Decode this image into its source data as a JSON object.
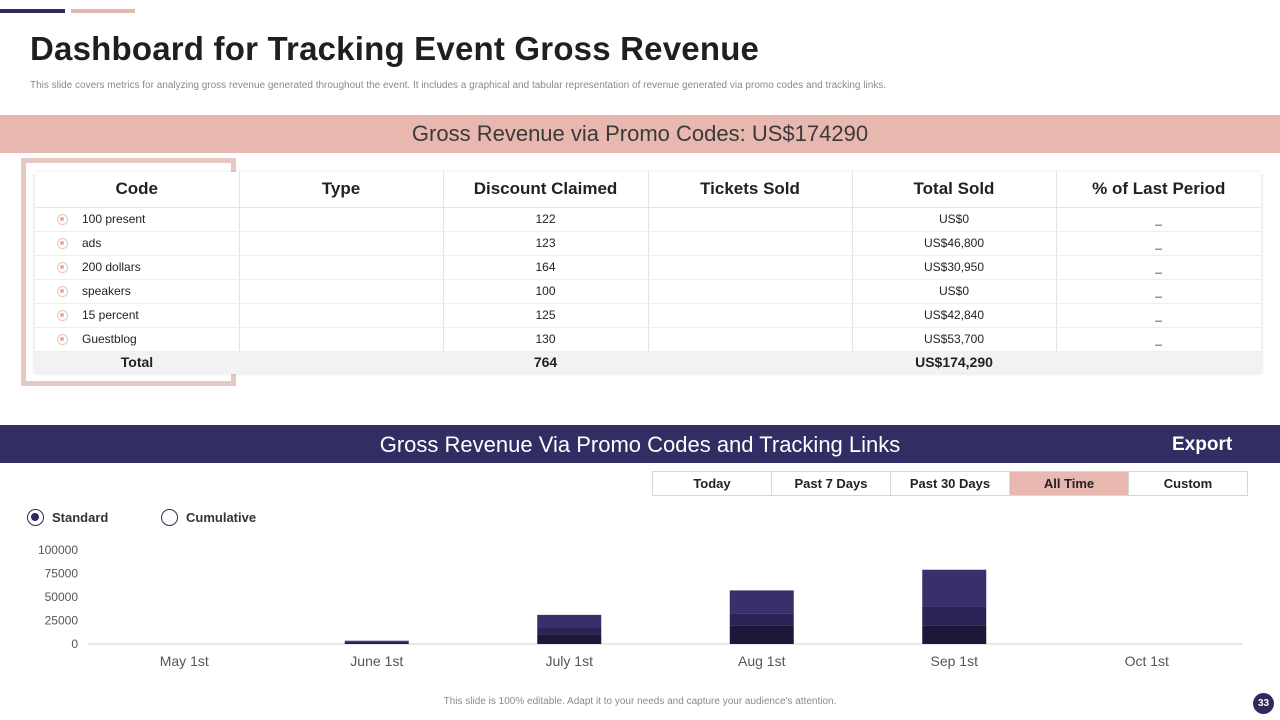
{
  "title": "Dashboard for Tracking Event Gross Revenue",
  "subtitle": "This slide covers metrics for analyzing gross revenue generated throughout the event. It includes a graphical and tabular representation of revenue generated via promo codes and tracking links.",
  "promo_band": {
    "text": "Gross Revenue via Promo Codes: US$174290"
  },
  "table": {
    "headers": [
      "Code",
      "Type",
      "Discount Claimed",
      "Tickets Sold",
      "Total Sold",
      "% of Last Period"
    ],
    "rows": [
      {
        "code": "100 present",
        "type": "",
        "discount": "122",
        "tickets": "",
        "total": "US$0",
        "pct": "_"
      },
      {
        "code": "ads",
        "type": "",
        "discount": "123",
        "tickets": "",
        "total": "US$46,800",
        "pct": "_"
      },
      {
        "code": "200 dollars",
        "type": "",
        "discount": "164",
        "tickets": "",
        "total": "US$30,950",
        "pct": "_"
      },
      {
        "code": "speakers",
        "type": "",
        "discount": "100",
        "tickets": "",
        "total": "US$0",
        "pct": "_"
      },
      {
        "code": "15 percent",
        "type": "",
        "discount": "125",
        "tickets": "",
        "total": "US$42,840",
        "pct": "_"
      },
      {
        "code": "Guestblog",
        "type": "",
        "discount": "130",
        "tickets": "",
        "total": "US$53,700",
        "pct": "_"
      }
    ],
    "total": {
      "label": "Total",
      "discount": "764",
      "total": "US$174,290"
    }
  },
  "tracking_band": {
    "text": "Gross Revenue Via Promo Codes and Tracking Links",
    "export_label": "Export"
  },
  "time_tabs": [
    "Today",
    "Past 7 Days",
    "Past 30 Days",
    "All Time",
    "Custom"
  ],
  "active_tab": "All Time",
  "radios": {
    "standard": "Standard",
    "cumulative": "Cumulative",
    "selected": "standard"
  },
  "colors": {
    "dark": "#2f2a5e",
    "pink": "#e8b8b0",
    "bar_light": "#37306b",
    "bar_mid": "#2a2456",
    "bar_dark": "#1c1838"
  },
  "chart_data": {
    "type": "bar",
    "stacked": true,
    "categories": [
      "May 1st",
      "June 1st",
      "July 1st",
      "Aug 1st",
      "Sep 1st",
      "Oct 1st"
    ],
    "series": [
      {
        "values": [
          0,
          1000,
          10000,
          20000,
          20000,
          0
        ]
      },
      {
        "values": [
          0,
          1500,
          8000,
          12000,
          20000,
          0
        ]
      },
      {
        "values": [
          0,
          1000,
          13000,
          25000,
          39000,
          0
        ]
      }
    ],
    "y_ticks": [
      0,
      25000,
      50000,
      75000,
      100000
    ],
    "ylim": [
      0,
      100000
    ],
    "grid": false
  },
  "footer": "This slide is 100% editable. Adapt it to your needs and capture your audience's attention.",
  "page_number": "33"
}
